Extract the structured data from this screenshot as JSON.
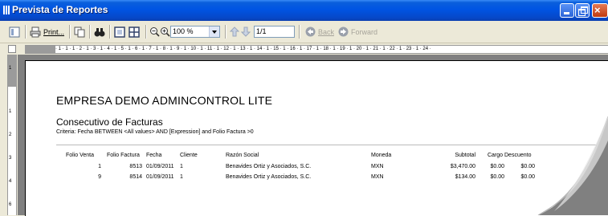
{
  "window": {
    "title": "Prevista de Reportes"
  },
  "toolbar": {
    "print_label": "Print...",
    "zoom_value": "100 %",
    "page_value": "1/1",
    "back_label": "Back",
    "forward_label": "Forward"
  },
  "ruler": {
    "horizontal": "· 1 · 1 · 1 · 2 · 1 · 3 · 1 · 4 · 1 · 5 · 1 · 6 · 1 · 7 · 1 · 8 · 1 · 9 · 1 · 10 · 1 · 11 · 1 · 12 · 1 · 13 · 1 · 14 · 1 · 15 · 1 · 16 · 1 · 17 · 1 · 18 · 1 · 19 · 1 · 20 · 1 · 21 · 1 · 22 · 1 · 23 · 1 · 24 ·",
    "vertical": [
      "1",
      "1",
      "2",
      "3",
      "4",
      "5",
      "6"
    ]
  },
  "report": {
    "company": "EMPRESA DEMO ADMINCONTROL LITE",
    "title": "Consecutivo de Facturas",
    "criteria": "Criteria: Fecha BETWEEN <All values> AND [Expression] and Folio Factura >0",
    "columns": {
      "folio_venta": "Folio Venta",
      "folio_factura": "Folio Factura",
      "fecha": "Fecha",
      "cliente": "Cliente",
      "razon_social": "Razón Social",
      "moneda": "Moneda",
      "subtotal": "Subtotal",
      "cargo": "Cargo",
      "descuento": "Descuento"
    },
    "rows": [
      {
        "folio_venta": "1",
        "folio_factura": "8513",
        "fecha": "01/09/2011",
        "cliente": "1",
        "razon_social": "Benavides Ortiz y Asociados, S.C.",
        "moneda": "MXN",
        "subtotal": "$3,470.00",
        "cargo": "$0.00",
        "descuento": "$0.00"
      },
      {
        "folio_venta": "9",
        "folio_factura": "8514",
        "fecha": "01/09/2011",
        "cliente": "1",
        "razon_social": "Benavides Ortiz y Asociados, S.C.",
        "moneda": "MXN",
        "subtotal": "$134.00",
        "cargo": "$0.00",
        "descuento": "$0.00"
      }
    ]
  }
}
